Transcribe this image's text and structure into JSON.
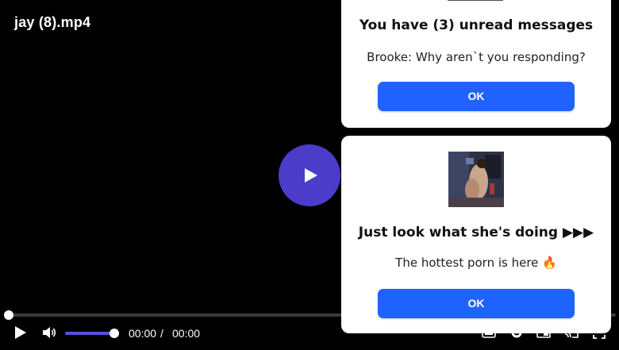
{
  "video": {
    "title": "jay (8).mp4",
    "current_time": "00:00",
    "separator": "/",
    "total_time": "00:00",
    "progress": 0,
    "volume": 1.0
  },
  "notifications": [
    {
      "title": "You have (3) unread messages",
      "body": "Brooke: Why aren`t you responding?",
      "button_label": "OK"
    },
    {
      "title": "Just look what she's doing ▶▶▶",
      "body": "The hottest porn is here 🔥",
      "button_label": "OK"
    }
  ],
  "colors": {
    "accent": "#4b3cc9",
    "button": "#1f63ff",
    "background": "#000000"
  },
  "icons": {
    "big_play": "play-icon",
    "play": "play-icon",
    "volume": "volume-icon",
    "right_controls": [
      "subtitles-icon",
      "settings-icon",
      "pip-icon",
      "cast-icon",
      "fullscreen-icon"
    ]
  }
}
